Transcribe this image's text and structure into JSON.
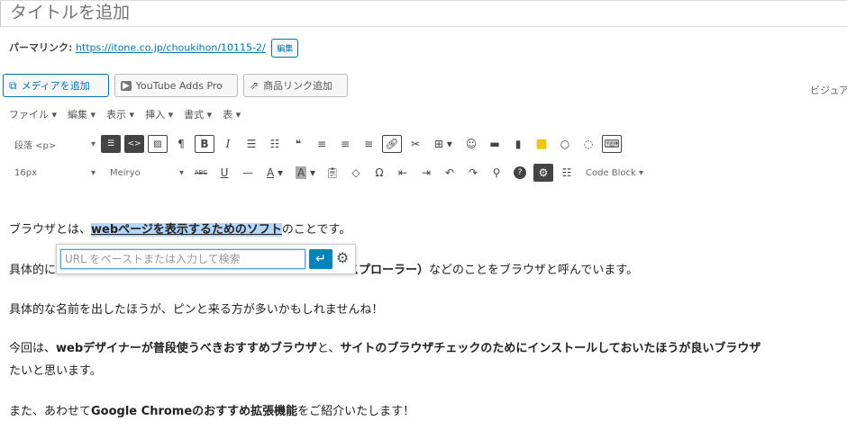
{
  "title": {
    "placeholder": "タイトルを追加"
  },
  "permalink": {
    "label": "パーマリンク:",
    "url": "https://itone.co.jp/choukihon/10115-2/",
    "edit": "編集"
  },
  "media_buttons": [
    {
      "label": "メディアを追加",
      "icon": "media-icon"
    },
    {
      "label": "YouTube Adds Pro",
      "icon": "youtube-icon"
    },
    {
      "label": "商品リンク追加",
      "icon": "share-icon"
    }
  ],
  "visual_tab": "ビジュア",
  "menubar": [
    "ファイル ▾",
    "編集 ▾",
    "表示 ▾",
    "挿入 ▾",
    "書式 ▾",
    "表 ▾"
  ],
  "toolbar1": {
    "format_select": "段落 <p>",
    "symbols": {
      "paragraph": "¶",
      "bold": "B",
      "italic": "I",
      "quote": "❝"
    }
  },
  "toolbar2": {
    "font_size": "16px",
    "font_family": "Meiryo",
    "code_block": "Code Block ▾",
    "symbols": {
      "strike": "ABC",
      "underline": "U",
      "hr": "—",
      "textcolor": "A",
      "bgcolor": "A",
      "omega": "Ω"
    }
  },
  "content": {
    "p1_before": "ブラウザとは、",
    "p1_selected": "webページを表示するためのソフト",
    "p1_after": "のことです。",
    "p2_start": "具体的に",
    "p2_bold": "スプローラー）",
    "p2_end": "などのことをブラウザと呼んでいます。",
    "p3": "具体的な名前を出したほうが、ピンと来る方が多いかもしれませんね！",
    "p4_a": "今回は、",
    "p4_b": "webデザイナーが普段使うべきおすすめブラウザ",
    "p4_c": "と、",
    "p4_d": "サイトのブラウザチェックのためにインストールしておいたほうが良いブラウザ",
    "p4_line2": "たいと思います。",
    "p5_a": "また、あわせて",
    "p5_b": "Google Chromeのおすすめ拡張機能",
    "p5_c": "をご紹介いたします！"
  },
  "link_popup": {
    "placeholder": "URL をペーストまたは入力して検索",
    "apply_symbol": "↵",
    "settings_symbol": "⚙"
  },
  "colors": {
    "accent": "#0073aa",
    "selection": "#b3d4fc",
    "apply_button": "#0085ba"
  }
}
